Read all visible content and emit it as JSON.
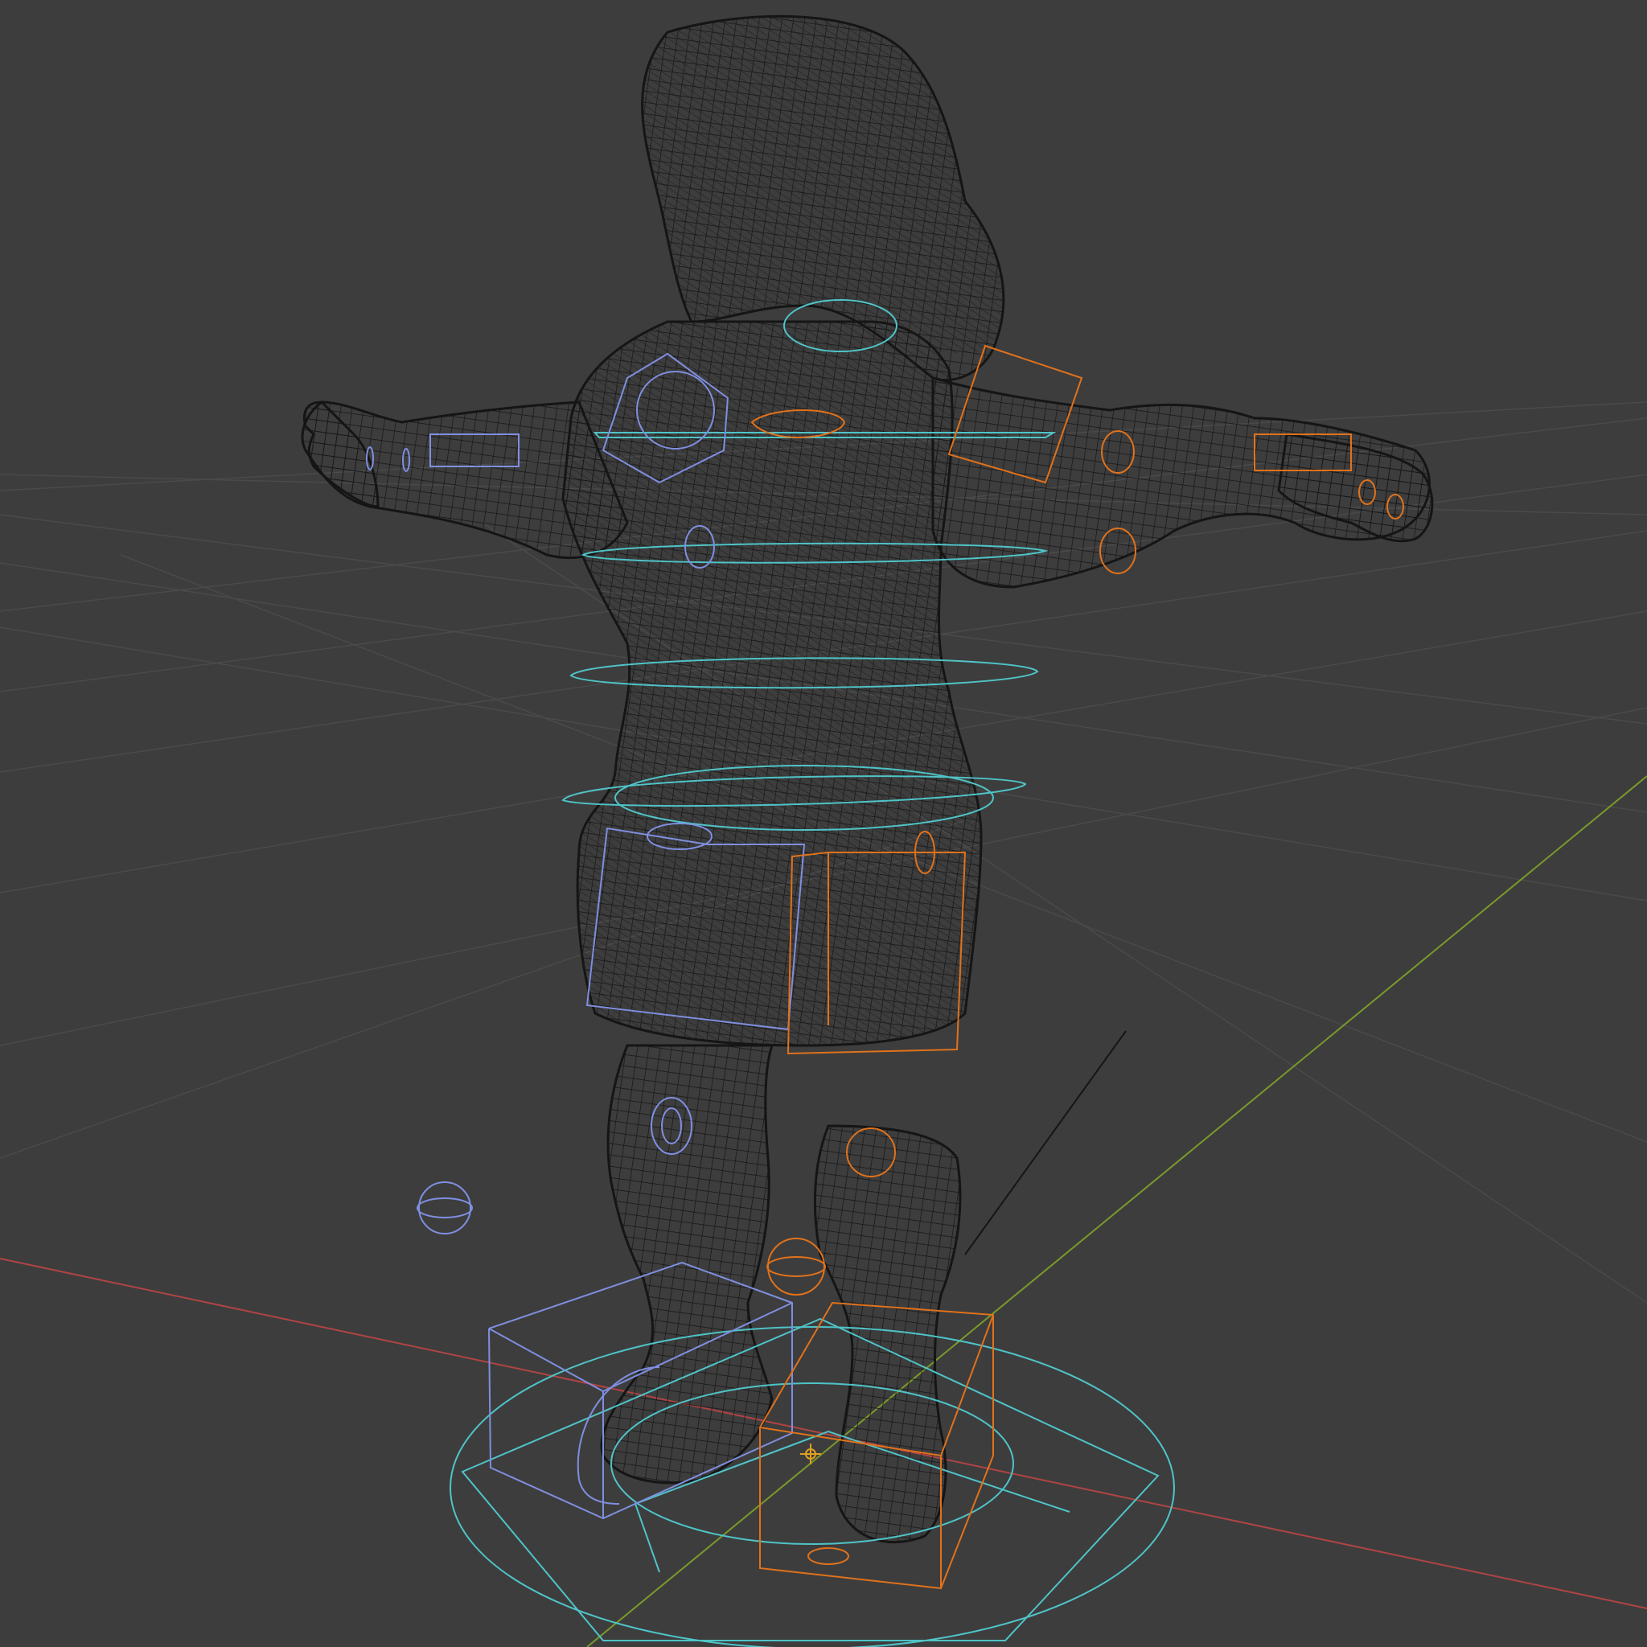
{
  "viewport": {
    "mode": "wireframe",
    "background_color": "#3d3d3d",
    "grid_color": "#4a4a4a",
    "x_axis_color": "#b04444",
    "y_axis_color": "#7a9a2a",
    "mesh_color": "#111111",
    "root_controls_color": "#4fc4c8",
    "left_controls_color": "#7f8fe0",
    "right_controls_color": "#e0721c",
    "origin_marker_color": "#e0a020"
  },
  "scene": {
    "object": "character-mesh",
    "rig": "control-rig",
    "pose": "T-pose",
    "view": "perspective"
  }
}
